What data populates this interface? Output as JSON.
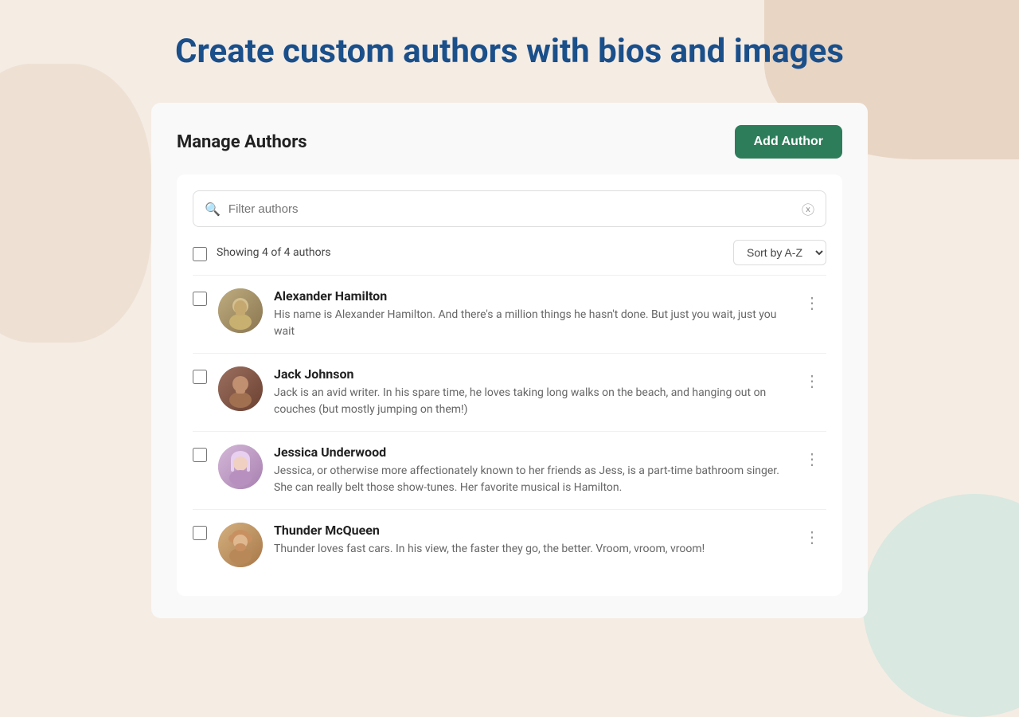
{
  "page": {
    "title": "Create custom authors with bios and images"
  },
  "card": {
    "title": "Manage Authors",
    "add_button_label": "Add Author"
  },
  "search": {
    "placeholder": "Filter authors",
    "value": ""
  },
  "list": {
    "showing_text": "Showing 4 of 4 authors",
    "sort_label": "Sort by A-Z",
    "authors": [
      {
        "id": "hamilton",
        "name": "Alexander Hamilton",
        "bio": "His name is Alexander Hamilton. And there’s a million things he hasn’t done. But just you wait, just you wait",
        "avatar_color_start": "#a09060",
        "avatar_color_end": "#7a6840"
      },
      {
        "id": "johnson",
        "name": "Jack Johnson",
        "bio": "Jack is an avid writer. In his spare time, he loves taking long walks on the beach, and hanging out on couches (but mostly jumping on them!)",
        "avatar_color_start": "#8b6355",
        "avatar_color_end": "#6b4535"
      },
      {
        "id": "underwood",
        "name": "Jessica Underwood",
        "bio": "Jessica, or otherwise more affectionately known to her friends as Jess, is a part-time bathroom singer. She can really belt those show-tunes. Her favorite musical is Hamilton.",
        "avatar_color_start": "#c4a0c8",
        "avatar_color_end": "#9b70a0"
      },
      {
        "id": "mcqueen",
        "name": "Thunder McQueen",
        "bio": "Thunder loves fast cars. In his view, the faster they go, the better. Vroom, vroom, vroom!",
        "avatar_color_start": "#c4a07a",
        "avatar_color_end": "#a07850"
      }
    ]
  }
}
